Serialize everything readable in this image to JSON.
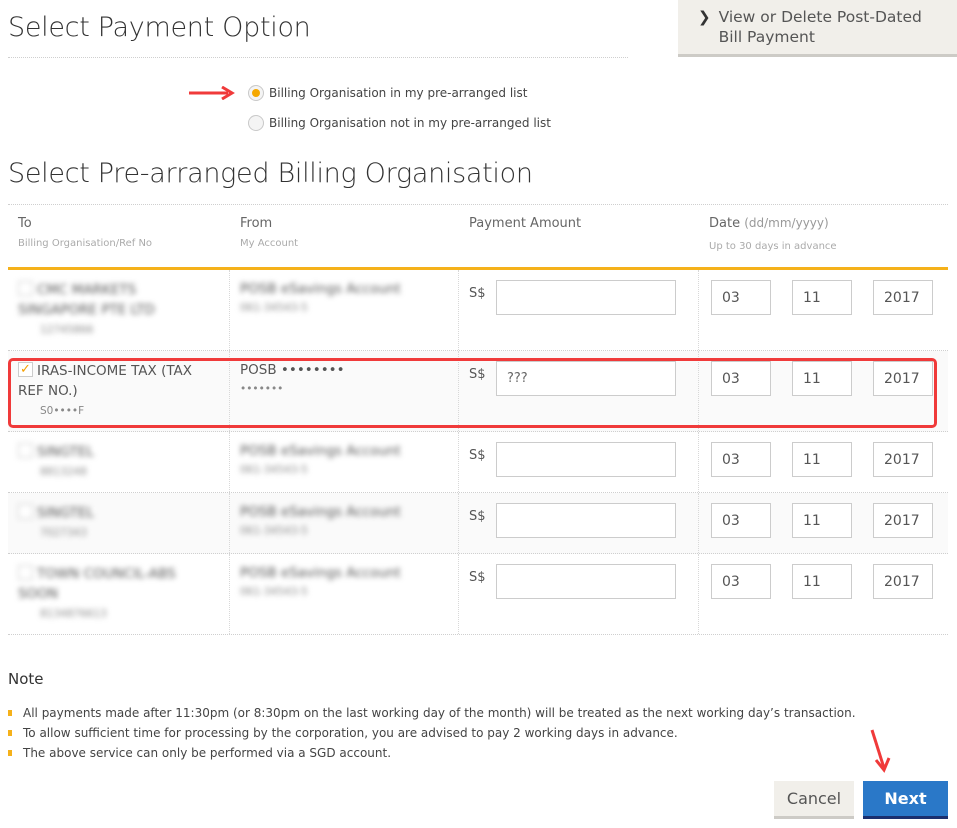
{
  "page_title": "Select Payment Option",
  "side_link": {
    "label": "View or Delete Post-Dated Bill Payment",
    "icon": "chevron-right-icon"
  },
  "payment_options": [
    {
      "label": "Billing Organisation in my pre-arranged list",
      "selected": true
    },
    {
      "label": "Billing Organisation not in my pre-arranged list",
      "selected": false
    }
  ],
  "section_title": "Select Pre-arranged Billing Organisation",
  "table": {
    "headers": [
      {
        "main": "To",
        "sub": "Billing Organisation/Ref No"
      },
      {
        "main": "From",
        "sub": "My Account"
      },
      {
        "main": "Payment Amount",
        "sub": ""
      },
      {
        "main": "Date",
        "main_suffix": "(dd/mm/yyyy)",
        "sub": "Up to 30 days in advance"
      }
    ],
    "currency": "S$",
    "rows": [
      {
        "org": "CMC MARKETS SINGAPORE PTE LTD",
        "ref": "12745866",
        "account": "POSB eSavings Account",
        "account_no": "061-34543-5",
        "amount": "",
        "day": "03",
        "month": "11",
        "year": "2017",
        "checked": false,
        "blurred": true
      },
      {
        "org": "IRAS-INCOME TAX (TAX REF NO.)",
        "ref": "S0••••F",
        "account": "POSB ••••••••",
        "account_no": "•••••••",
        "amount": "???",
        "day": "03",
        "month": "11",
        "year": "2017",
        "checked": true,
        "blurred": false
      },
      {
        "org": "SINGTEL",
        "ref": "8813248",
        "account": "POSB eSavings Account",
        "account_no": "061-34543-5",
        "amount": "",
        "day": "03",
        "month": "11",
        "year": "2017",
        "checked": false,
        "blurred": true
      },
      {
        "org": "SINGTEL",
        "ref": "7027343",
        "account": "POSB eSavings Account",
        "account_no": "061-34543-5",
        "amount": "",
        "day": "03",
        "month": "11",
        "year": "2017",
        "checked": false,
        "blurred": true
      },
      {
        "org": "TOWN COUNCIL-ABS SOON",
        "ref": "8134876613",
        "account": "POSB eSavings Account",
        "account_no": "061-34543-5",
        "amount": "",
        "day": "03",
        "month": "11",
        "year": "2017",
        "checked": false,
        "blurred": true
      }
    ]
  },
  "note": {
    "title": "Note",
    "items": [
      "All payments made after 11:30pm (or 8:30pm on the last working day of the month) will be treated as the next working day’s transaction.",
      "To allow sufficient time for processing by the corporation, you are advised to pay 2 working days in advance.",
      "The above service can only be performed via a SGD account."
    ]
  },
  "buttons": {
    "cancel": "Cancel",
    "next": "Next"
  },
  "colors": {
    "accent": "#f5b11a",
    "primary": "#2a78c8",
    "highlight": "#f03a3a"
  }
}
